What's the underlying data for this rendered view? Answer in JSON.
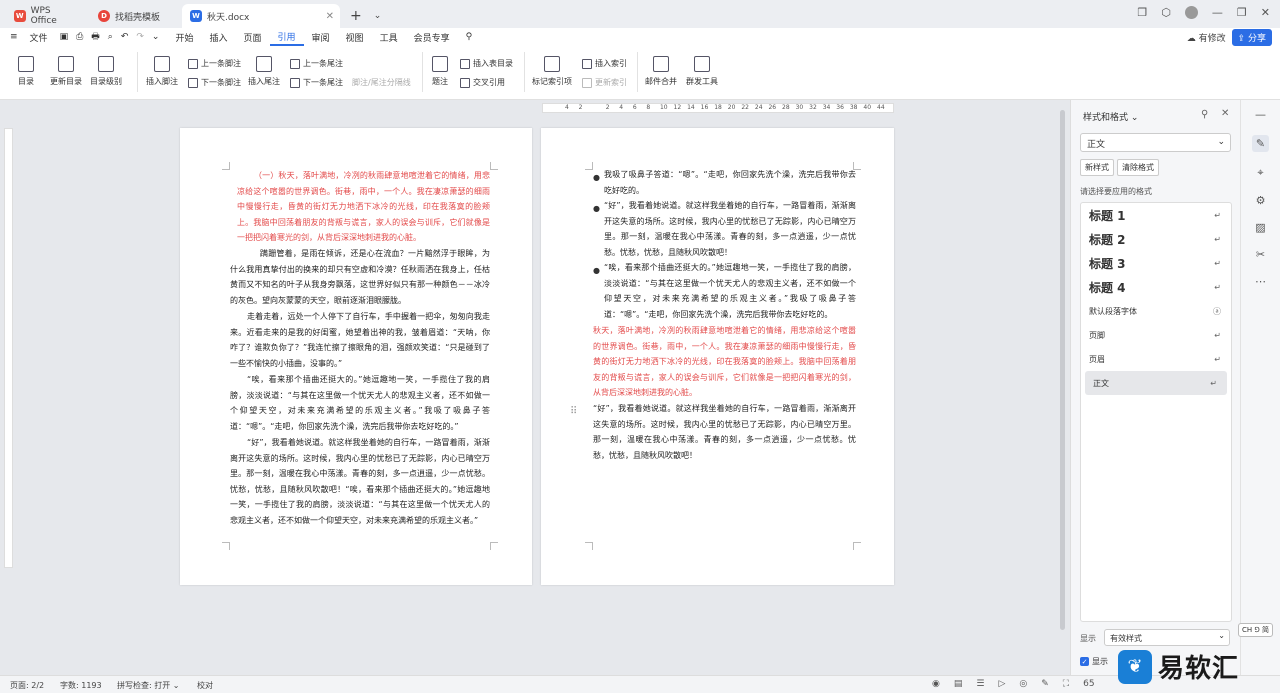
{
  "tabs": [
    {
      "label": "WPS Office"
    },
    {
      "label": "找稻壳模板"
    },
    {
      "label": "秋天.docx"
    }
  ],
  "menus": [
    "文件",
    "开始",
    "插入",
    "页面",
    "引用",
    "审阅",
    "视图",
    "工具",
    "会员专享"
  ],
  "menu_right": {
    "edit": "有修改",
    "share": "分享"
  },
  "ribbon": {
    "toc": "目录",
    "update_toc": "更新目录",
    "toc_level": "目录级别",
    "insert_footnote": "插入脚注",
    "prev_footnote": "上一条脚注",
    "next_footnote": "下一条脚注",
    "insert_endnote": "插入尾注",
    "prev_endnote": "上一条尾注",
    "next_endnote": "下一条尾注",
    "separator": "脚注/尾注分隔线",
    "caption": "题注",
    "insert_table_toc": "插入表目录",
    "cross_ref": "交叉引用",
    "mark_index": "标记索引项",
    "insert_index": "插入索引",
    "update_index": "更新索引",
    "mail_merge": "邮件合并",
    "group_tools": "群发工具"
  },
  "ruler": [
    "4",
    "2",
    "",
    "2",
    "4",
    "6",
    "8",
    "10",
    "12",
    "14",
    "16",
    "18",
    "20",
    "22",
    "24",
    "26",
    "28",
    "30",
    "32",
    "34",
    "36",
    "38",
    "40",
    "44"
  ],
  "page1": {
    "p1": "（一）秋天，落叶满地，冷冽的秋雨肆意地喧泄着它的情绪，用悲凉给这个喧嚣的世界调色。街巷，雨中，一个人。我在凄凉萧瑟的细雨中慢慢行走，昏黄的街灯无力地洒下冰冷的光线，印在我落寞的脸颊上。我脑中回荡着朋友的背叛与谎言，家人的误会与训斥，它们就像是一把把闪着寒光的剑，从背后深深地刺进我的心脏。",
    "p2": "蹒跚管着，是雨在倾诉，还是心在流血？一片黯然浮于眼眸，为什么我用真挚付出的换来的却只有空虚和冷漠？任秋雨洒在我身上，任枯黄而又不知名的叶子从我身旁飘落，这世界好似只有那一种颜色－－冰冷的灰色。望向灰蒙蒙的天空，眼前逐渐泪眼朦胧。",
    "p3": "走着走着，远处一个人停下了自行车，手中握着一把伞，匆匆向我走来。近看走来的是我的好闺蜜，她望着出神的我，皱着眉道：“天呐，你咋了？谁欺负你了？”我连忙擦了擦眼角的泪，强颜欢笑道：“只是碰到了一些不愉快的小插曲，没事的。”",
    "p4": "“唉，看来那个插曲还挺大的。”她逗趣地一笑，一手揽住了我的肩膀，淡淡说道：“与其在这里做一个忧天尤人的悲观主义者，还不如做一个仰望天空，对未来充满希望的乐观主义者。”我吸了吸鼻子答道：“嗯”。“走吧，你回家先洗个澡，洗完后我带你去吃好吃的。”",
    "p5": "“好”，我看着她说道。就这样我坐着她的自行车，一路冒着雨，渐渐离开这失意的场所。这时候，我内心里的忧愁已了无踪影，内心已晴空万里。那一刻，温暖在我心中荡漾。青春的刻，多一点逍遥，少一点忧愁。忧愁，忧愁，且随秋风吹散吧！“唉，看来那个插曲还挺大的。”她逗趣地一笑，一手揽住了我的肩膀，淡淡说道：“与其在这里做一个忧天尤人的悲观主义者，还不如做一个仰望天空，对未来充满希望的乐观主义者。”"
  },
  "page2": {
    "b1": "我吸了吸鼻子答道：“嗯”。“走吧，你回家先洗个澡，洗完后我带你去吃好吃的。",
    "b2": "“好”，我看着她说道。就这样我坐着她的自行车，一路冒着雨，渐渐离开这失意的场所。这时候，我内心里的忧愁已了无踪影，内心已晴空万里。那一刻，温暖在我心中荡漾。青春的刻，多一点逍遥，少一点忧愁。忧愁，忧愁，且随秋风吹散吧！",
    "b3": "“唉，看来那个插曲还挺大的。”她逗趣地一笑，一手揽住了我的肩膀，淡淡说道：“与其在这里做一个忧天尤人的悲观主义者，还不如做一个仰望天空，对未来充满希望的乐观主义者。”我吸了吸鼻子答道：“嗯”。“走吧，你回家先洗个澡，洗完后我带你去吃好吃的。",
    "red": "秋天，落叶满地，冷冽的秋雨肆意地喧泄着它的情绪，用悲凉给这个喧嚣的世界调色。街巷，雨中，一个人。我在凄凉萧瑟的细雨中慢慢行走，昏黄的街灯无力地洒下冰冷的光线，印在我落寞的脸颊上。我脑中回荡着朋友的背叛与谎言，家人的误会与训斥，它们就像是一把把闪着寒光的剑，从背后深深地刺进我的心脏。",
    "rest": "“好”，我看着她说道。就这样我坐着她的自行车，一路冒着雨，渐渐离开这失意的场所。这时候，我内心里的忧愁已了无踪影，内心已晴空万里。那一刻，温暖在我心中荡漾。青春的刻，多一点逍遥，少一点忧愁。忧愁，忧愁，且随秋风吹散吧！"
  },
  "panel": {
    "title": "样式和格式",
    "current": "正文",
    "new_style": "新样式",
    "clear_format": "清除格式",
    "choose_label": "请选择要应用的格式",
    "styles": [
      "标题 1",
      "标题 2",
      "标题 3",
      "标题 4",
      "默认段落字体",
      "页脚",
      "页眉",
      "正文"
    ],
    "show_label": "显示",
    "show_value": "有效样式",
    "preview_label": "显示"
  },
  "status": {
    "page": "页面: 2/2",
    "words": "字数: 1193",
    "spell": "拼写检查: 打开",
    "proof": "校对",
    "zoom": "65"
  },
  "ime": "CH ⅁ 简",
  "watermark": "易软汇"
}
